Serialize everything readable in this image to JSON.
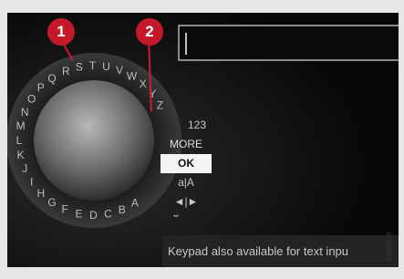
{
  "screen": {
    "text_field_value": "",
    "dial_letters": [
      "R",
      "S",
      "T",
      "U",
      "V",
      "W",
      "X",
      "Y",
      "Z",
      "Q",
      "P",
      "O",
      "N",
      "M",
      "L",
      "K",
      "J",
      "I",
      "H",
      "G",
      "F",
      "E",
      "D",
      "C",
      "B",
      "A"
    ],
    "side_menu": [
      {
        "label": "123",
        "selected": false
      },
      {
        "label": "MORE",
        "selected": false
      },
      {
        "label": "OK",
        "selected": true
      },
      {
        "label": "a|A",
        "selected": false
      },
      {
        "label": "◄|►",
        "selected": false
      }
    ],
    "space_glyph": "⎵",
    "footer_text": "Keypad also available for text inpu"
  },
  "callouts": [
    "1",
    "2"
  ],
  "image_code": "G050518",
  "colors": {
    "callout": "#c5182b",
    "screen": "#101010",
    "frame": "#e7e7e7"
  }
}
